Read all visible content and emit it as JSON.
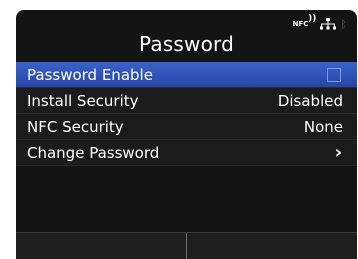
{
  "status": {
    "nfc_text": "NFC",
    "nfc_waves": "))",
    "icons": [
      "nfc-icon",
      "network-icon",
      "bluetooth-icon"
    ]
  },
  "title": "Password",
  "menu": {
    "items": [
      {
        "label": "Password Enable",
        "value": "",
        "control": "checkbox",
        "checked": false,
        "selected": true
      },
      {
        "label": "Install Security",
        "value": "Disabled"
      },
      {
        "label": "NFC Security",
        "value": "None"
      },
      {
        "label": "Change Password",
        "value": "›"
      }
    ]
  },
  "softkeys": [
    "",
    ""
  ],
  "colors": {
    "screen_bg": "#141414",
    "selected_row": "#3355b8",
    "text": "#ffffff"
  }
}
